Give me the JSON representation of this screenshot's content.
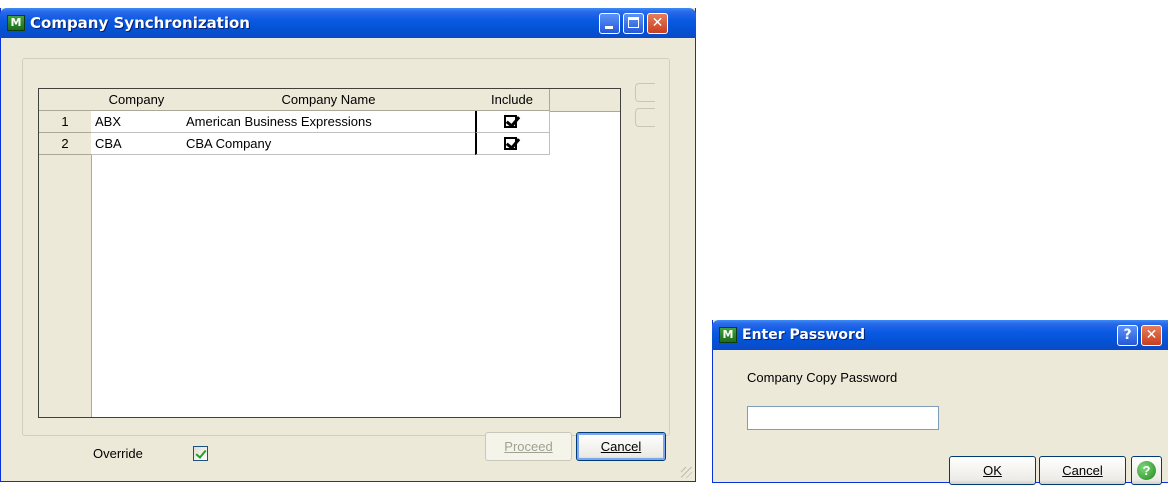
{
  "main_window": {
    "title": "Company Synchronization",
    "app_icon": "MAS-logo-icon",
    "grid": {
      "columns": [
        "Company",
        "Company Name",
        "Include"
      ],
      "rows": [
        {
          "num": "1",
          "company": "ABX",
          "name": "American Business Expressions",
          "include": true
        },
        {
          "num": "2",
          "company": "CBA",
          "name": "CBA Company",
          "include": true
        }
      ]
    },
    "override_label": "Override",
    "override_checked": true,
    "proceed_label": "Proceed",
    "cancel_label": "Cancel"
  },
  "password_dialog": {
    "title": "Enter Password",
    "help_title_button": "?",
    "field_label": "Company Copy Password",
    "password_value": "",
    "ok_label": "OK",
    "cancel_label": "Cancel"
  },
  "colors": {
    "titlebar": "#0a5ae3",
    "dialog_face": "#ece9d8",
    "close_button": "#c5401f",
    "check_green": "#21a121"
  }
}
